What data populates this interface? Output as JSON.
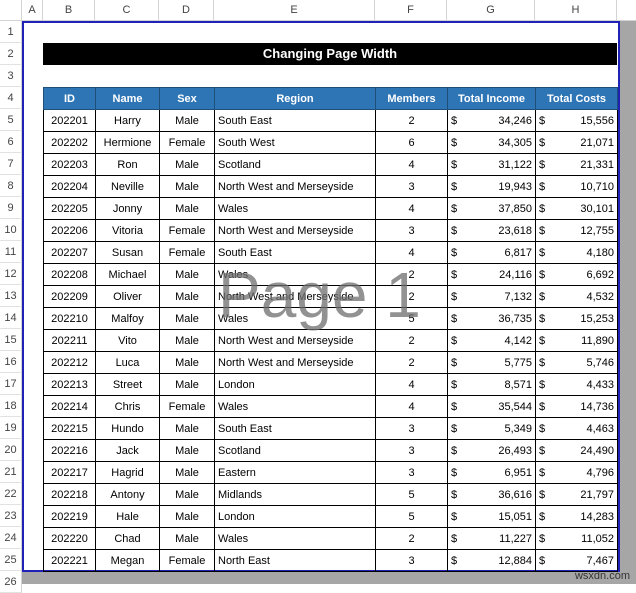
{
  "columns": [
    "A",
    "B",
    "C",
    "D",
    "E",
    "F",
    "G",
    "H"
  ],
  "title": "Changing Page Width",
  "watermark": "Page 1",
  "site_mark": "wsxdn.com",
  "headers": [
    "ID",
    "Name",
    "Sex",
    "Region",
    "Members",
    "Total Income",
    "Total Costs"
  ],
  "currency": "$",
  "rows": [
    [
      "202201",
      "Harry",
      "Male",
      "South East",
      "2",
      "34,246",
      "15,556"
    ],
    [
      "202202",
      "Hermione",
      "Female",
      "South West",
      "6",
      "34,305",
      "21,071"
    ],
    [
      "202203",
      "Ron",
      "Male",
      "Scotland",
      "4",
      "31,122",
      "21,331"
    ],
    [
      "202204",
      "Neville",
      "Male",
      "North West and Merseyside",
      "3",
      "19,943",
      "10,710"
    ],
    [
      "202205",
      "Jonny",
      "Male",
      "Wales",
      "4",
      "37,850",
      "30,101"
    ],
    [
      "202206",
      "Vitoria",
      "Female",
      "North West and Merseyside",
      "3",
      "23,618",
      "12,755"
    ],
    [
      "202207",
      "Susan",
      "Female",
      "South East",
      "4",
      "6,817",
      "4,180"
    ],
    [
      "202208",
      "Michael",
      "Male",
      "Wales",
      "2",
      "24,116",
      "6,692"
    ],
    [
      "202209",
      "Oliver",
      "Male",
      "North West and Merseyside",
      "2",
      "7,132",
      "4,532"
    ],
    [
      "202210",
      "Malfoy",
      "Male",
      "Wales",
      "5",
      "36,735",
      "15,253"
    ],
    [
      "202211",
      "Vito",
      "Male",
      "North West and Merseyside",
      "2",
      "4,142",
      "11,890"
    ],
    [
      "202212",
      "Luca",
      "Male",
      "North West and Merseyside",
      "2",
      "5,775",
      "5,746"
    ],
    [
      "202213",
      "Street",
      "Male",
      "London",
      "4",
      "8,571",
      "4,433"
    ],
    [
      "202214",
      "Chris",
      "Female",
      "Wales",
      "4",
      "35,544",
      "14,736"
    ],
    [
      "202215",
      "Hundo",
      "Male",
      "South East",
      "3",
      "5,349",
      "4,463"
    ],
    [
      "202216",
      "Jack",
      "Male",
      "Scotland",
      "3",
      "26,493",
      "24,490"
    ],
    [
      "202217",
      "Hagrid",
      "Male",
      "Eastern",
      "3",
      "6,951",
      "4,796"
    ],
    [
      "202218",
      "Antony",
      "Male",
      "Midlands",
      "5",
      "36,616",
      "21,797"
    ],
    [
      "202219",
      "Hale",
      "Male",
      "London",
      "5",
      "15,051",
      "14,283"
    ],
    [
      "202220",
      "Chad",
      "Male",
      "Wales",
      "2",
      "11,227",
      "11,052"
    ],
    [
      "202221",
      "Megan",
      "Female",
      "North East",
      "3",
      "12,884",
      "7,467"
    ]
  ],
  "colors": {
    "header": "#2e75b6",
    "page_border": "#1f22b4",
    "title_bg": "#000000"
  }
}
